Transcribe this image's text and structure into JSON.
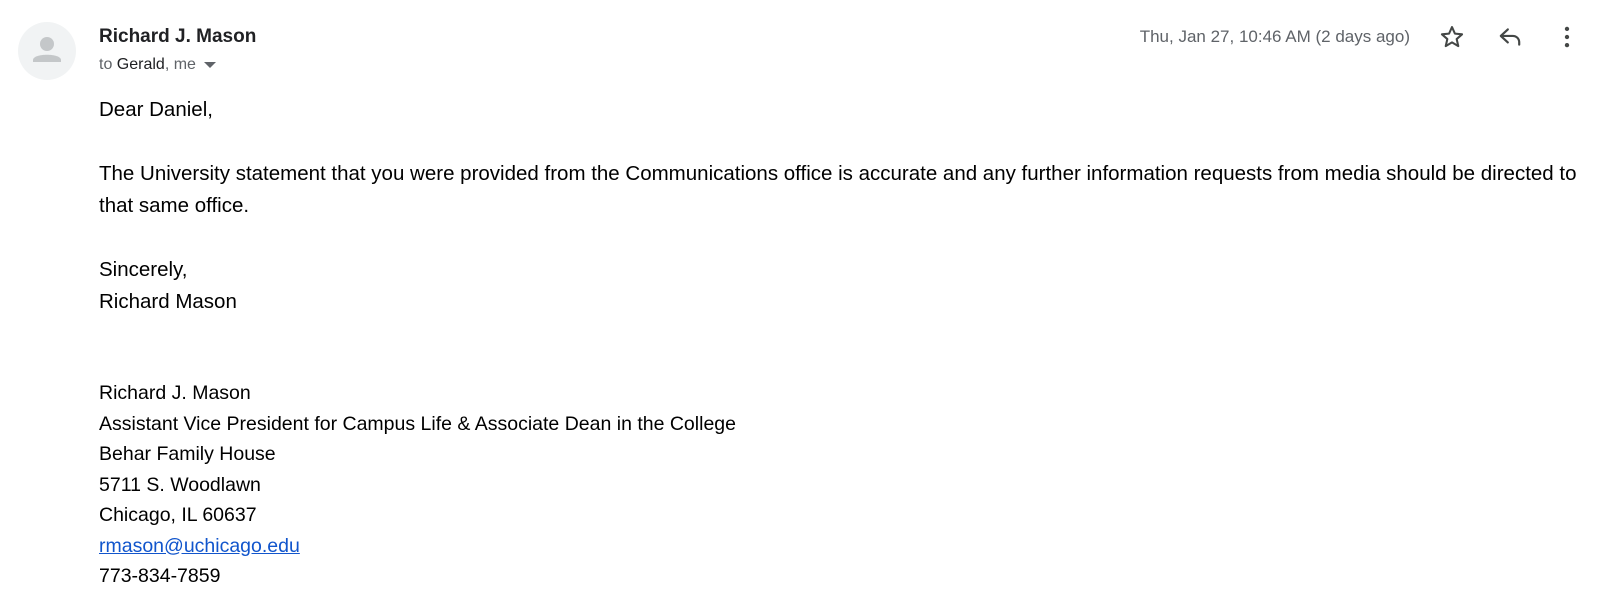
{
  "header": {
    "sender_name": "Richard J. Mason",
    "to_prefix": "to",
    "to_primary": "Gerald",
    "to_rest": ", me",
    "timestamp": "Thu, Jan 27, 10:46 AM (2 days ago)"
  },
  "icons": {
    "avatar": "person-avatar-icon",
    "star": "star-outline-icon",
    "reply": "reply-arrow-icon",
    "more": "more-vert-icon",
    "caret": "chevron-down-icon"
  },
  "body": {
    "greeting": "Dear Daniel,",
    "paragraph": "The University statement that you were provided from the Communications office is accurate and any further information requests from media should be directed to that same office.",
    "closing": "Sincerely,",
    "closing_name": "Richard Mason"
  },
  "signature": {
    "name": "Richard J. Mason",
    "title": "Assistant Vice President for Campus Life & Associate Dean in the College",
    "building": "Behar Family House",
    "street": "5711 S. Woodlawn",
    "city": "Chicago, IL 60637",
    "email": "rmason@uchicago.edu",
    "phone": "773-834-7859"
  },
  "colors": {
    "link": "#1155cc",
    "secondary_text": "#5f6368",
    "avatar_bg": "#f1f3f4"
  }
}
